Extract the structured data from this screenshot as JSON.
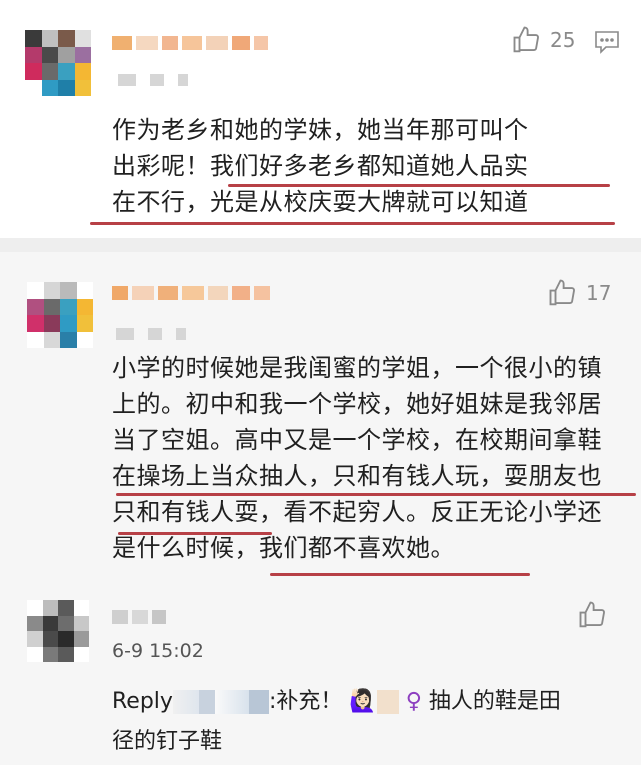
{
  "comments": [
    {
      "likes": "25",
      "lines": [
        "作为老乡和她的学妹，她当年那可叫个",
        "出彩呢！我们好多老乡都知道她人品实",
        "在不行，光是从校庆耍大牌就可以知道"
      ]
    },
    {
      "likes": "17",
      "lines": [
        "小学的时候她是我闺蜜的学姐，一个很小的镇",
        "上的。初中和我一个学校，她好姐妹是我邻居",
        "当了空姐。高中又是一个学校，在校期间拿鞋",
        "在操场上当众抽人，只和有钱人玩，耍朋友也",
        "只和有钱人耍，看不起穷人。反正无论小学还",
        "是什么时候，我们都不喜欢她。"
      ]
    }
  ],
  "reply": {
    "timestamp": "6-9 15:02",
    "prefix": "Reply",
    "text_a": ":补充！",
    "emoji_a": "🙋🏻‍♀️",
    "emoji_b": "♀",
    "text_b": "抽人的鞋是田",
    "text_c": "径的钉子鞋"
  },
  "icons": {
    "like": "thumbs-up-icon",
    "comment": "comment-icon"
  },
  "colors": {
    "underline": "#b74046",
    "muted": "#8a8a8a"
  }
}
